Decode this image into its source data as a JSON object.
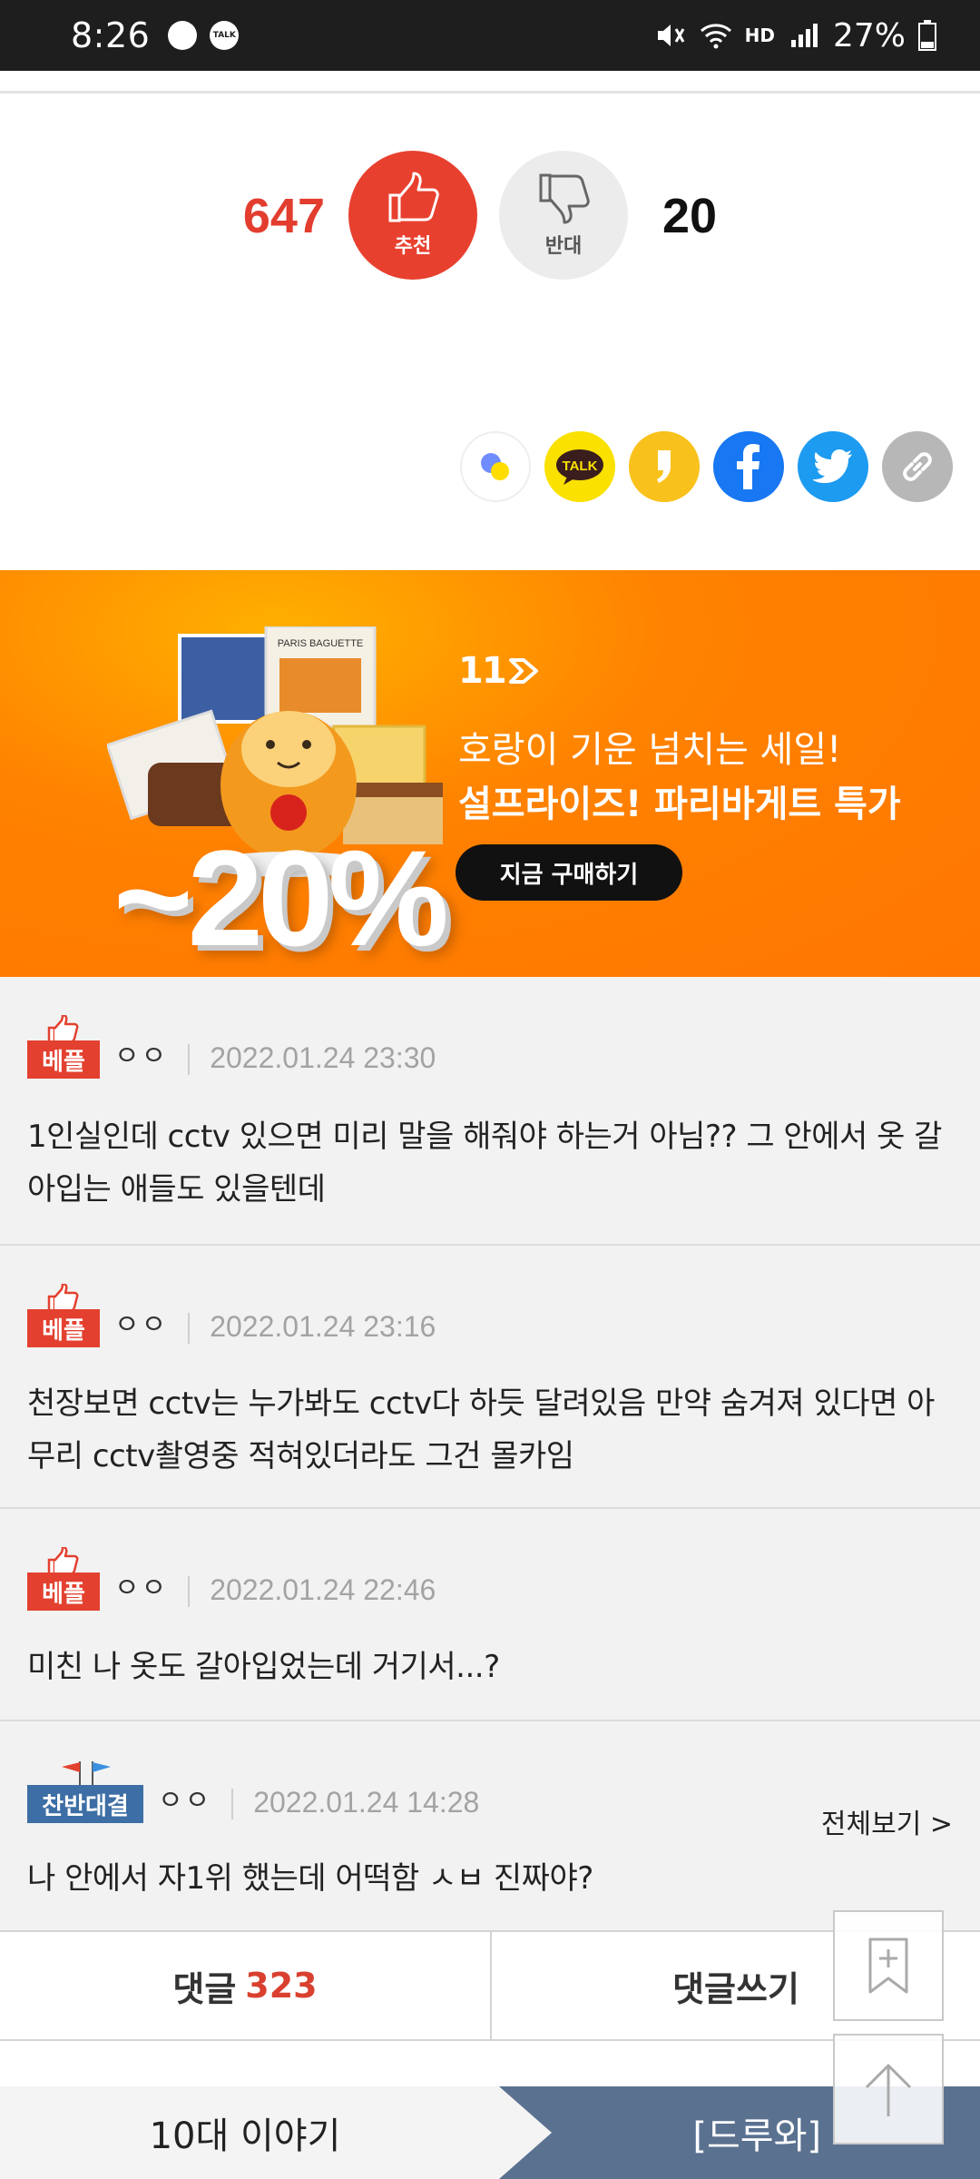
{
  "status_bar": {
    "time": "8:26",
    "battery": "27%",
    "network_label": "HD"
  },
  "vote": {
    "up_count": "647",
    "up_label": "추천",
    "down_label": "반대",
    "down_count": "20"
  },
  "share": {
    "items": [
      "kakaostory-icon",
      "kakaotalk-icon",
      "kakaopage-icon",
      "facebook-icon",
      "twitter-icon",
      "link-icon"
    ],
    "talk_text": "TALK"
  },
  "banner": {
    "logo": "11",
    "headline": "호랑이 기운 넘치는 세일!",
    "subheadline": "설프라이즈! 파리바게트 특가",
    "cta": "지금 구매하기",
    "discount": "~20%",
    "box_text": "PARIS BAGUETTE",
    "colors": {
      "background": "#ff8200"
    }
  },
  "comments": [
    {
      "badge": "베플",
      "nickname": "ㅇㅇ",
      "date": "2022.01.24 23:30",
      "text": "1인실인데 cctv 있으면 미리 말을 해줘야 하는거 아님?? 그 안에서 옷 갈아입는 애들도 있을텐데"
    },
    {
      "badge": "베플",
      "nickname": "ㅇㅇ",
      "date": "2022.01.24 23:16",
      "text": "천장보면 cctv는 누가봐도 cctv다 하듯 달려있음 만약 숨겨져 있다면 아무리 cctv촬영중 적혀있더라도 그건 몰카임"
    },
    {
      "badge": "베플",
      "nickname": "ㅇㅇ",
      "date": "2022.01.24 22:46",
      "text": "미친 나 옷도 갈아입었는데 거기서...?"
    },
    {
      "badge": "찬반대결",
      "nickname": "ㅇㅇ",
      "date": "2022.01.24 14:28",
      "text": "나 안에서 자1위 했는데 어떡함 ㅅㅂ 진짜야?",
      "see_all": "전체보기 >"
    }
  ],
  "bottom_tabs": {
    "comments_label": "댓글",
    "comments_count": "323",
    "write_label": "댓글쓰기"
  },
  "board_nav": {
    "left": "10대 이야기",
    "right": "[드루와]"
  },
  "floating": {
    "bookmark": "bookmark-add-icon",
    "top": "arrow-up-icon"
  }
}
